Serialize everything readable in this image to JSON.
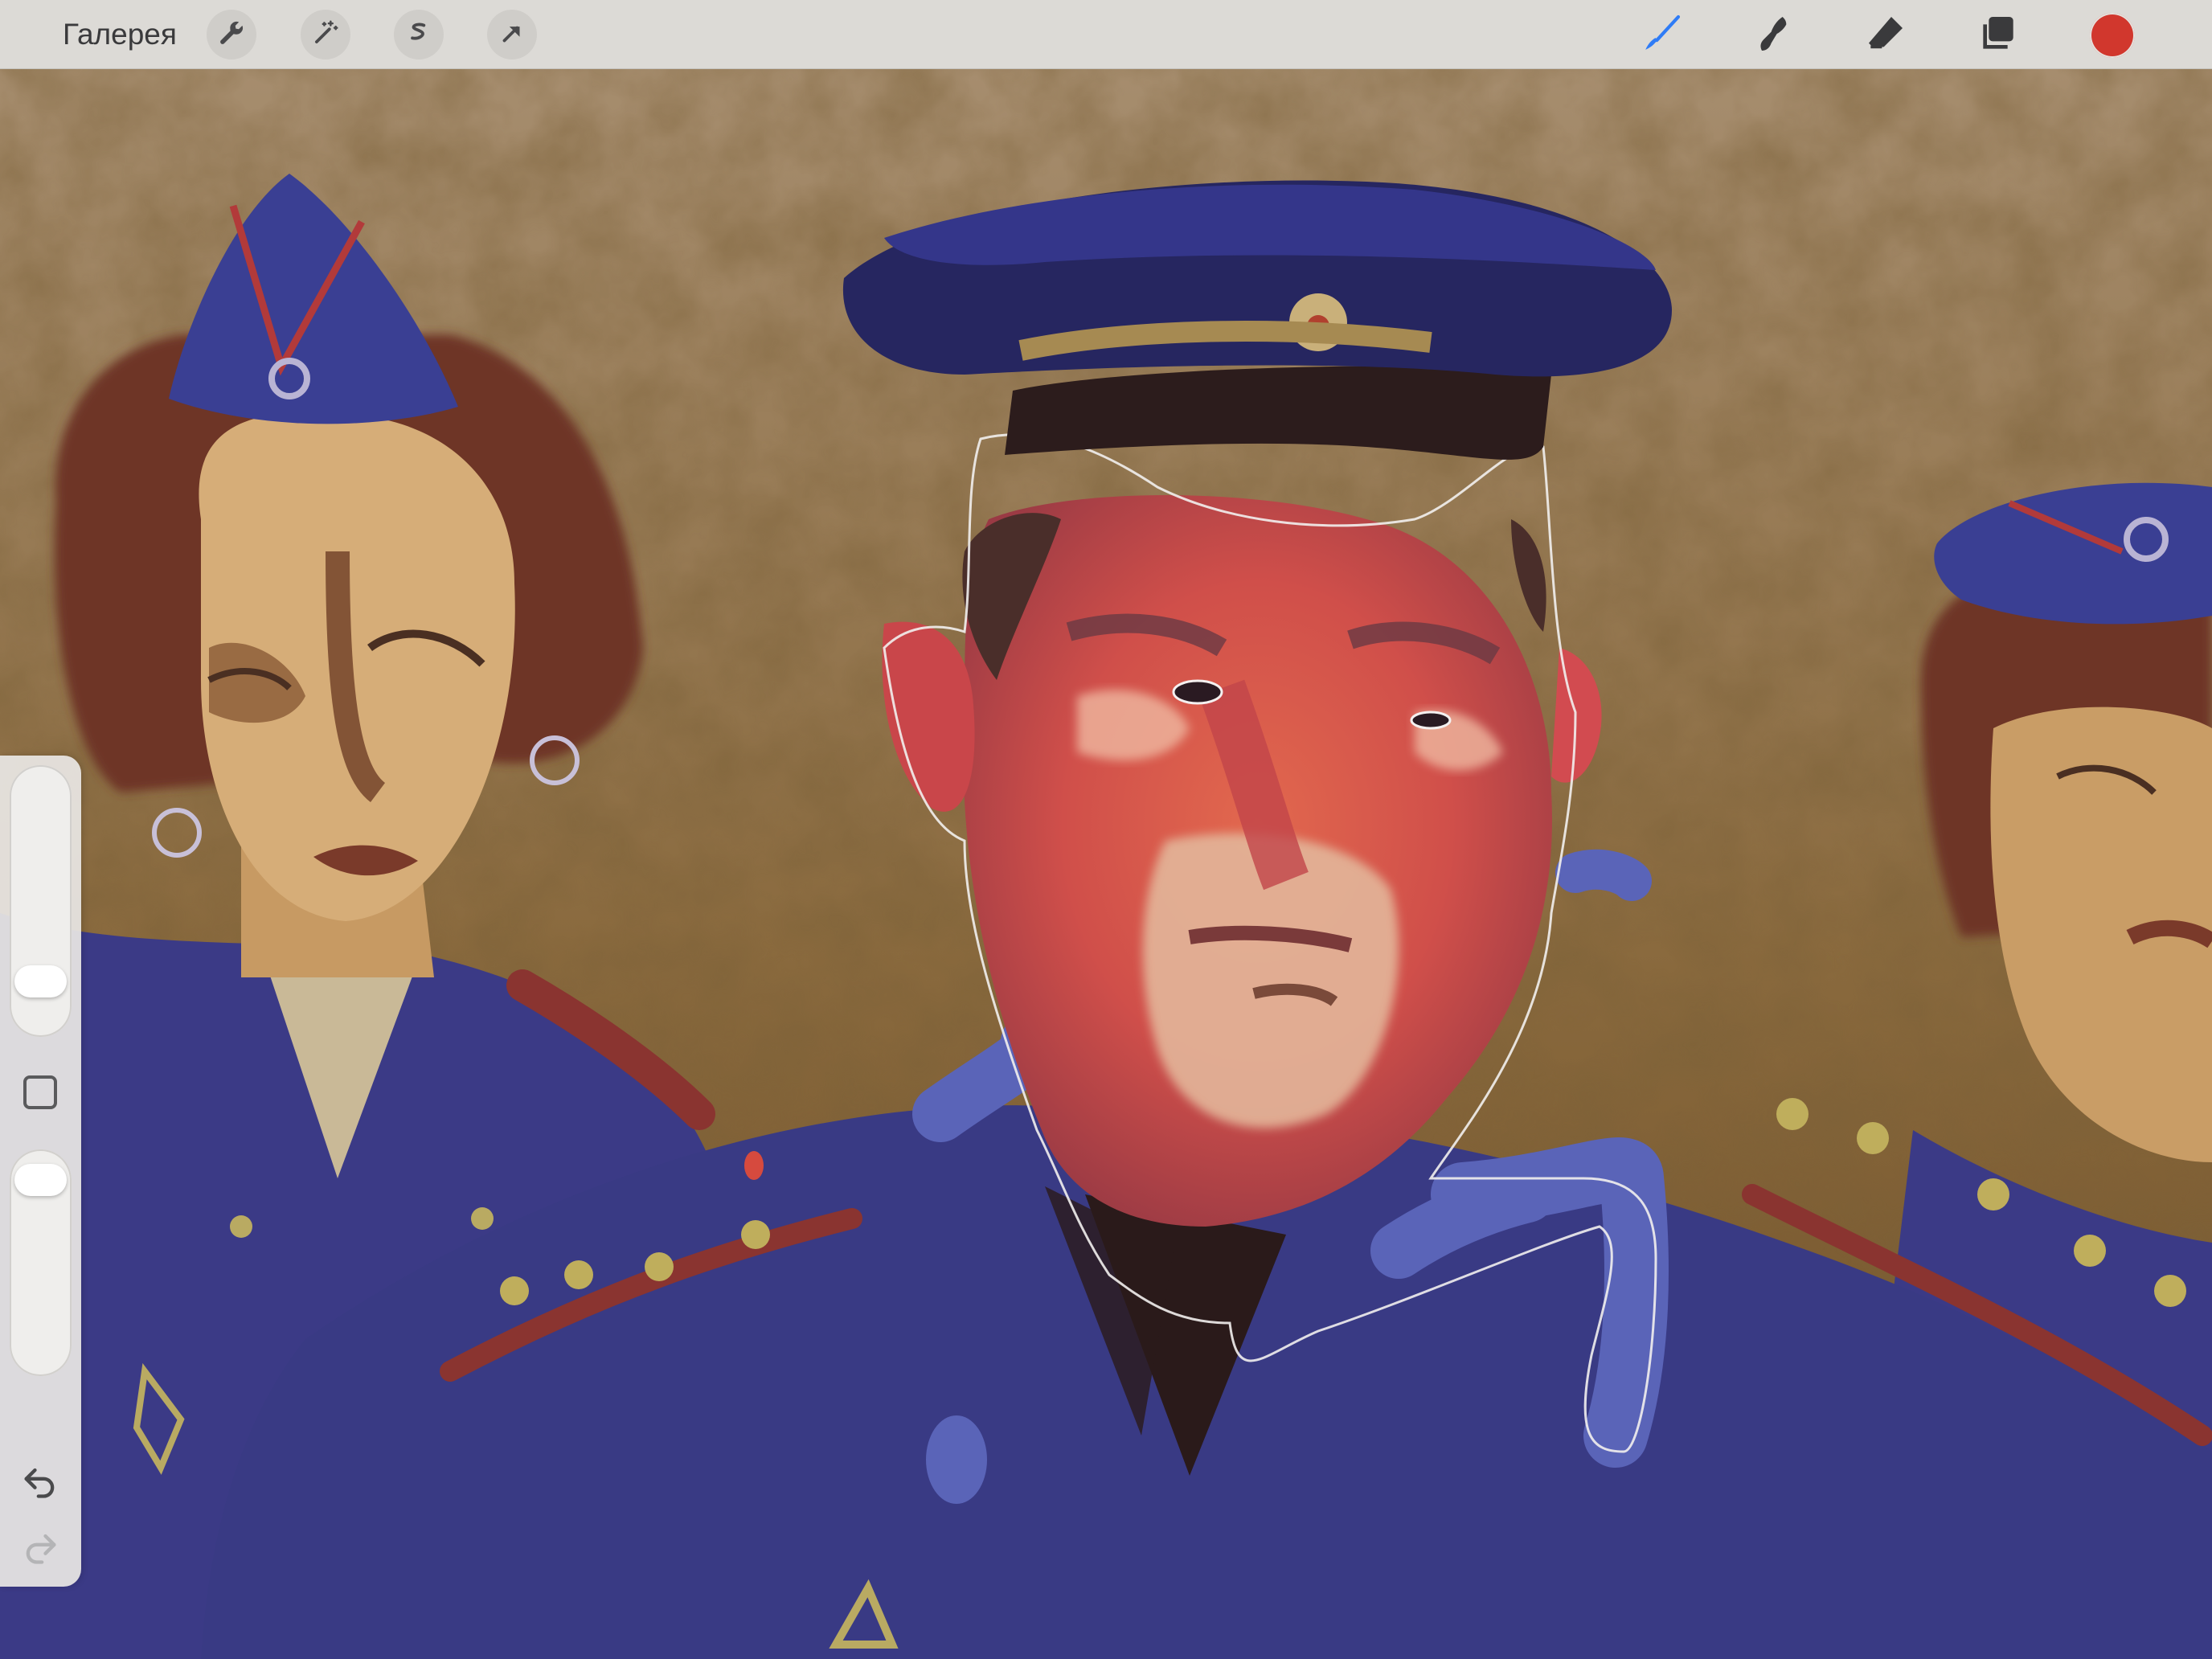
{
  "toolbar": {
    "gallery_label": "Галерея",
    "left_tools": [
      {
        "name": "wrench-icon",
        "label": "actions"
      },
      {
        "name": "magic-wand-icon",
        "label": "adjustments"
      },
      {
        "name": "selection-s-icon",
        "label": "selection"
      },
      {
        "name": "transform-arrow-icon",
        "label": "transform"
      }
    ],
    "right_tools": [
      {
        "name": "brush-icon",
        "label": "paint",
        "active": true
      },
      {
        "name": "smudge-icon",
        "label": "smudge"
      },
      {
        "name": "eraser-icon",
        "label": "erase"
      },
      {
        "name": "layers-icon",
        "label": "layers"
      }
    ],
    "current_color": "#d1372d",
    "active_tool_color": "#2f7cf6"
  },
  "sidebar": {
    "brush_size_level": 0.15,
    "brush_opacity_level": 0.95,
    "icons": [
      "square-modify-icon",
      "undo-icon",
      "redo-icon"
    ]
  },
  "canvas": {
    "subject": "painting"
  }
}
